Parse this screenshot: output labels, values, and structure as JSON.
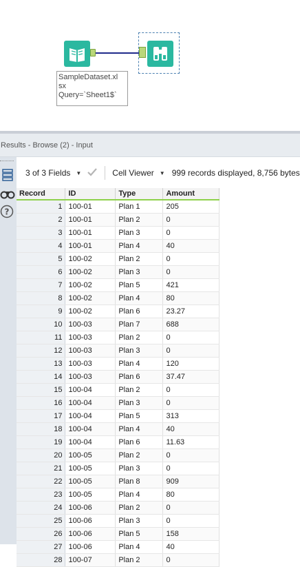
{
  "canvas": {
    "annotation": "SampleDataset.xl\nsx\nQuery=`Sheet1$`"
  },
  "results": {
    "title": "Results - Browse (2) - Input"
  },
  "toolbar": {
    "fields_label": "3 of 3 Fields",
    "viewer_label": "Cell Viewer",
    "status": "999 records displayed, 8,756 bytes"
  },
  "rail": {
    "icons": [
      "table-icon",
      "binoculars-icon",
      "help-icon"
    ]
  },
  "grid": {
    "columns": [
      "Record",
      "ID",
      "Type",
      "Amount"
    ],
    "rows": [
      [
        "1",
        "100-01",
        "Plan 1",
        "205"
      ],
      [
        "2",
        "100-01",
        "Plan 2",
        "0"
      ],
      [
        "3",
        "100-01",
        "Plan 3",
        "0"
      ],
      [
        "4",
        "100-01",
        "Plan 4",
        "40"
      ],
      [
        "5",
        "100-02",
        "Plan 2",
        "0"
      ],
      [
        "6",
        "100-02",
        "Plan 3",
        "0"
      ],
      [
        "7",
        "100-02",
        "Plan 5",
        "421"
      ],
      [
        "8",
        "100-02",
        "Plan 4",
        "80"
      ],
      [
        "9",
        "100-02",
        "Plan 6",
        "23.27"
      ],
      [
        "10",
        "100-03",
        "Plan 7",
        "688"
      ],
      [
        "11",
        "100-03",
        "Plan 2",
        "0"
      ],
      [
        "12",
        "100-03",
        "Plan 3",
        "0"
      ],
      [
        "13",
        "100-03",
        "Plan 4",
        "120"
      ],
      [
        "14",
        "100-03",
        "Plan 6",
        "37.47"
      ],
      [
        "15",
        "100-04",
        "Plan 2",
        "0"
      ],
      [
        "16",
        "100-04",
        "Plan 3",
        "0"
      ],
      [
        "17",
        "100-04",
        "Plan 5",
        "313"
      ],
      [
        "18",
        "100-04",
        "Plan 4",
        "40"
      ],
      [
        "19",
        "100-04",
        "Plan 6",
        "11.63"
      ],
      [
        "20",
        "100-05",
        "Plan 2",
        "0"
      ],
      [
        "21",
        "100-05",
        "Plan 3",
        "0"
      ],
      [
        "22",
        "100-05",
        "Plan 8",
        "909"
      ],
      [
        "23",
        "100-05",
        "Plan 4",
        "80"
      ],
      [
        "24",
        "100-06",
        "Plan 2",
        "0"
      ],
      [
        "25",
        "100-06",
        "Plan 3",
        "0"
      ],
      [
        "26",
        "100-06",
        "Plan 5",
        "158"
      ],
      [
        "27",
        "100-06",
        "Plan 4",
        "40"
      ],
      [
        "28",
        "100-07",
        "Plan 2",
        "0"
      ]
    ]
  }
}
